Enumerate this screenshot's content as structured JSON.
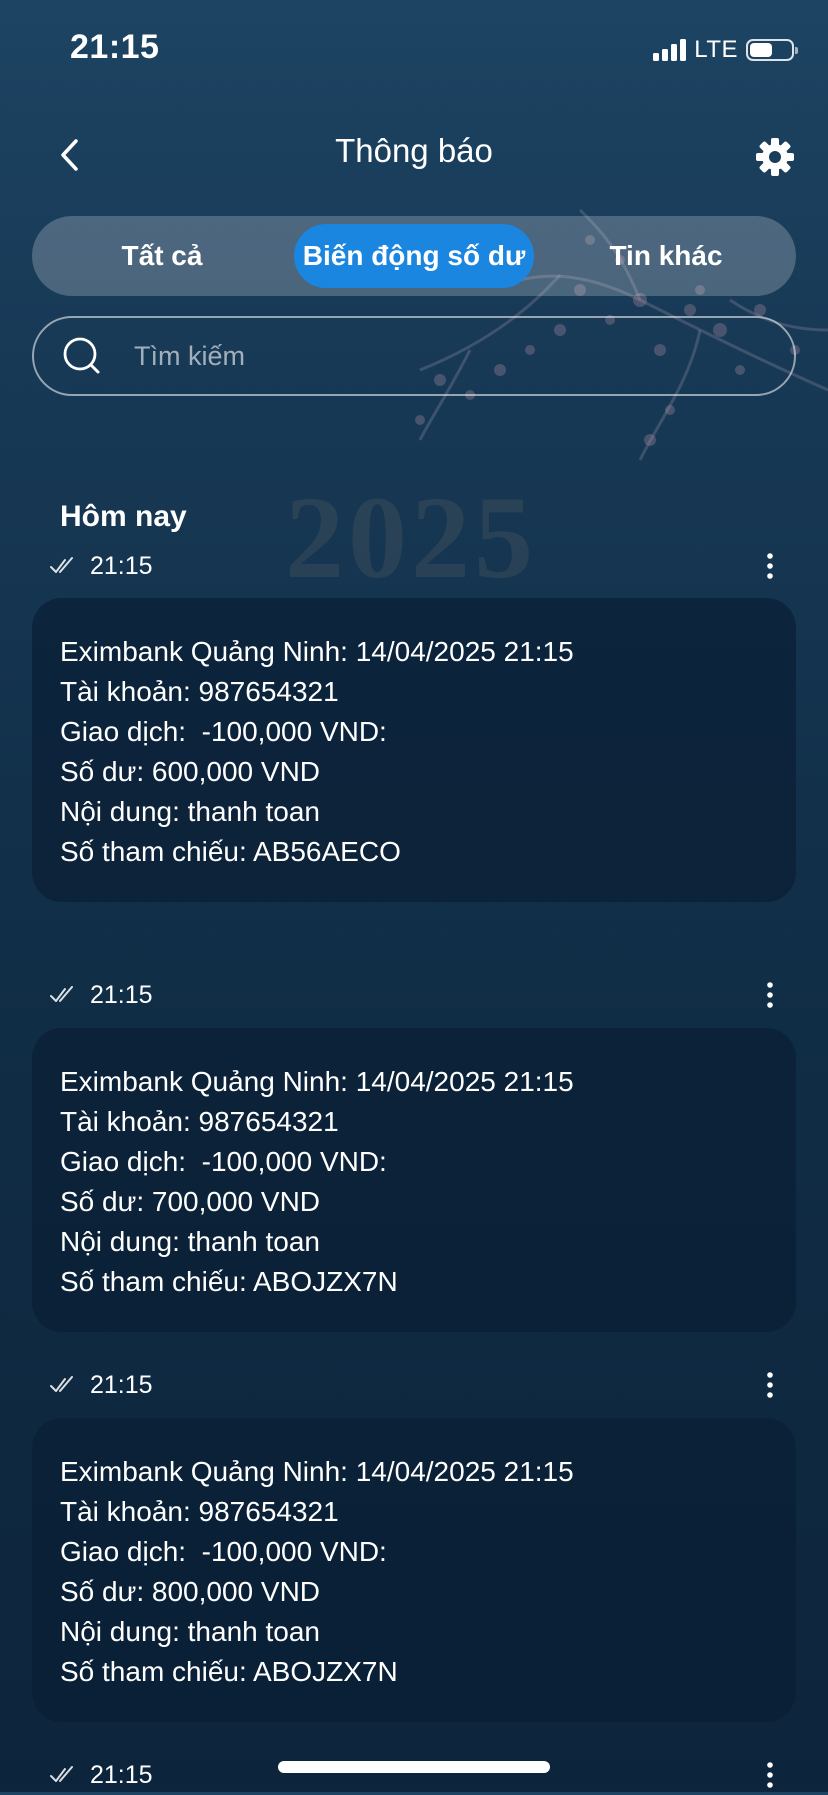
{
  "status_bar": {
    "time": "21:15",
    "network": "LTE",
    "signal_bars": 4,
    "battery_level": 0.55
  },
  "header": {
    "title": "Thông báo",
    "back_icon": "chevron-left-icon",
    "settings_icon": "gear-icon"
  },
  "tabs": [
    {
      "label": "Tất cả",
      "active": false
    },
    {
      "label": "Biến động số dư",
      "active": true
    },
    {
      "label": "Tin khác",
      "active": false
    }
  ],
  "search": {
    "placeholder": "Tìm kiếm",
    "value": ""
  },
  "background": {
    "year_text": "2025"
  },
  "section": {
    "title": "Hôm nay"
  },
  "messages": [
    {
      "time": "21:15",
      "lines": [
        "Eximbank Quảng Ninh: 14/04/2025 21:15",
        "Tài khoản: 987654321",
        "Giao dịch:  -100,000 VND:",
        "Số dư: 600,000 VND",
        "Nội dung: thanh toan",
        "Số tham chiếu: AB56AECO"
      ]
    },
    {
      "time": "21:15",
      "lines": [
        "Eximbank Quảng Ninh: 14/04/2025 21:15",
        "Tài khoản: 987654321",
        "Giao dịch:  -100,000 VND:",
        "Số dư: 700,000 VND",
        "Nội dung: thanh toan",
        "Số tham chiếu: ABOJZX7N"
      ]
    },
    {
      "time": "21:15",
      "lines": [
        "Eximbank Quảng Ninh: 14/04/2025 21:15",
        "Tài khoản: 987654321",
        "Giao dịch:  -100,000 VND:",
        "Số dư: 800,000 VND",
        "Nội dung: thanh toan",
        "Số tham chiếu: ABOJZX7N"
      ]
    },
    {
      "time": "21:15",
      "lines": []
    }
  ],
  "colors": {
    "accent": "#1b86e0",
    "background_top": "#1d4463",
    "background_bottom": "#0d253c",
    "card": "#0a1e34"
  }
}
